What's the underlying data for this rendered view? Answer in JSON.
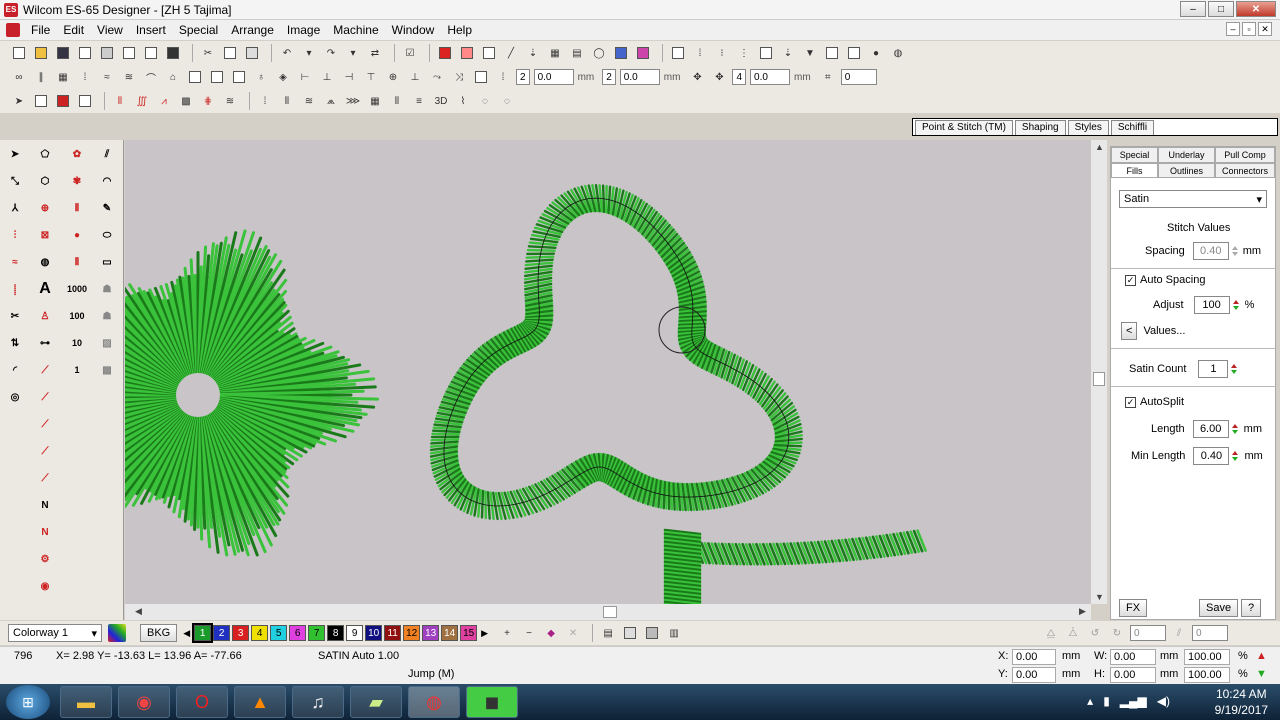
{
  "window": {
    "title": "Wilcom ES-65 Designer - [ZH 5        Tajima]"
  },
  "menu": [
    "File",
    "Edit",
    "View",
    "Insert",
    "Special",
    "Arrange",
    "Image",
    "Machine",
    "Window",
    "Help"
  ],
  "toolbar2": {
    "field1": "2",
    "field2": "0.0",
    "unit1": "mm",
    "field3": "2",
    "field4": "0.0",
    "unit2": "mm",
    "field5": "4",
    "field6": "0.0",
    "unit3": "mm",
    "field7": "0"
  },
  "toolbar3": {
    "label_3d": "3D"
  },
  "top_tabs": [
    "Point & Stitch (TM)",
    "Shaping",
    "Styles",
    "Schiffli"
  ],
  "toolbox": {
    "label_1000": "1000",
    "label_100": "100",
    "label_10": "10",
    "label_1": "1",
    "label_A": "A"
  },
  "panel": {
    "tabs_row1": [
      "Special",
      "Underlay",
      "Pull Comp"
    ],
    "tabs_row2": [
      "Fills",
      "Outlines",
      "Connectors"
    ],
    "fill_type": "Satin",
    "heading": "Stitch Values",
    "spacing_label": "Spacing",
    "spacing_value": "0.40",
    "spacing_unit": "mm",
    "auto_spacing_label": "Auto Spacing",
    "auto_spacing_checked": "✓",
    "adjust_label": "Adjust",
    "adjust_value": "100",
    "adjust_unit": "%",
    "values_button": "Values...",
    "values_arrow": "<",
    "satin_count_label": "Satin Count",
    "satin_count_value": "1",
    "autosplit_label": "AutoSplit",
    "autosplit_checked": "✓",
    "length_label": "Length",
    "length_value": "6.00",
    "length_unit": "mm",
    "min_length_label": "Min Length",
    "min_length_value": "0.40",
    "min_length_unit": "mm",
    "fx_button": "FX",
    "save_button": "Save",
    "help_button": "?"
  },
  "colorbar": {
    "colorway": "Colorway 1",
    "bkg": "BKG",
    "swatches": [
      {
        "n": "1",
        "color": "#1a9a2a",
        "text": "#ffffff"
      },
      {
        "n": "2",
        "color": "#2030c0",
        "text": "#ffffff"
      },
      {
        "n": "3",
        "color": "#d82020",
        "text": "#ffffff"
      },
      {
        "n": "4",
        "color": "#f0e000",
        "text": "#000000"
      },
      {
        "n": "5",
        "color": "#20d0e0",
        "text": "#000000"
      },
      {
        "n": "6",
        "color": "#e040e0",
        "text": "#000000"
      },
      {
        "n": "7",
        "color": "#30c030",
        "text": "#000000"
      },
      {
        "n": "8",
        "color": "#000000",
        "text": "#ffffff"
      },
      {
        "n": "9",
        "color": "#ffffff",
        "text": "#000000"
      },
      {
        "n": "10",
        "color": "#101080",
        "text": "#ffffff"
      },
      {
        "n": "11",
        "color": "#901010",
        "text": "#ffffff"
      },
      {
        "n": "12",
        "color": "#f08020",
        "text": "#000000"
      },
      {
        "n": "13",
        "color": "#a040c0",
        "text": "#ffffff"
      },
      {
        "n": "14",
        "color": "#a07040",
        "text": "#ffffff"
      },
      {
        "n": "15",
        "color": "#e040a0",
        "text": "#000000"
      }
    ],
    "right_field1": "0",
    "right_field2": "0"
  },
  "status": {
    "stitch_count": "796",
    "coords": "X=  2.98 Y= -13.63 L=  13.96 A= -77.66",
    "mode": "SATIN Auto  1.00",
    "jump": "Jump (M)",
    "x_label": "X:",
    "x_value": "0.00",
    "x_unit": "mm",
    "y_label": "Y:",
    "y_value": "0.00",
    "y_unit": "mm",
    "w_label": "W:",
    "w_value": "0.00",
    "w_unit": "mm",
    "w_pct": "100.00",
    "w_pct_unit": "%",
    "h_label": "H:",
    "h_value": "0.00",
    "h_unit": "mm",
    "h_pct": "100.00",
    "h_pct_unit": "%"
  },
  "taskbar": {
    "time": "10:24 AM",
    "date": "9/19/2017"
  },
  "colors": {
    "stitch_green": "#3ac23a",
    "stitch_dark": "#1a7a1a",
    "canvas_bg": "#c8c4c8"
  }
}
